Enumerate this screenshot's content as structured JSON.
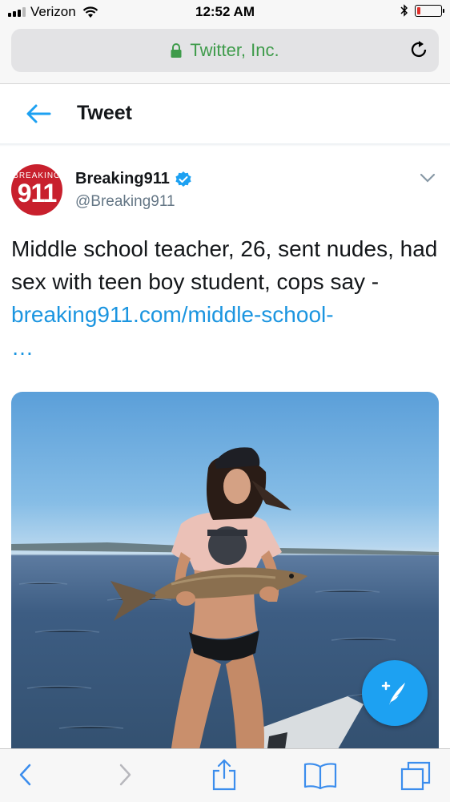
{
  "status_bar": {
    "carrier": "Verizon",
    "time": "12:52 AM",
    "battery_level": 0.15
  },
  "browser": {
    "url_title": "Twitter, Inc.",
    "colors": {
      "secure": "#3e9b4a",
      "toolbar_icons": "#3b8ded"
    }
  },
  "header": {
    "title": "Tweet"
  },
  "tweet": {
    "avatar_text_top": "BREAKING",
    "avatar_text_main": "911",
    "display_name": "Breaking911",
    "handle": "@Breaking911",
    "text": "Middle school teacher, 26, sent nudes, had sex with teen boy student, cops say - ",
    "link": "breaking911.com/middle-school-",
    "ellipsis": "…",
    "colors": {
      "link": "#1b95e0",
      "avatar": "#c8202d"
    }
  },
  "icons": {
    "back": "arrow-left-icon",
    "verified": "verified-badge-icon",
    "more": "chevron-down-icon",
    "compose": "compose-tweet-icon",
    "share": "share-icon",
    "bookmarks": "book-icon",
    "tabs": "tabs-icon"
  }
}
